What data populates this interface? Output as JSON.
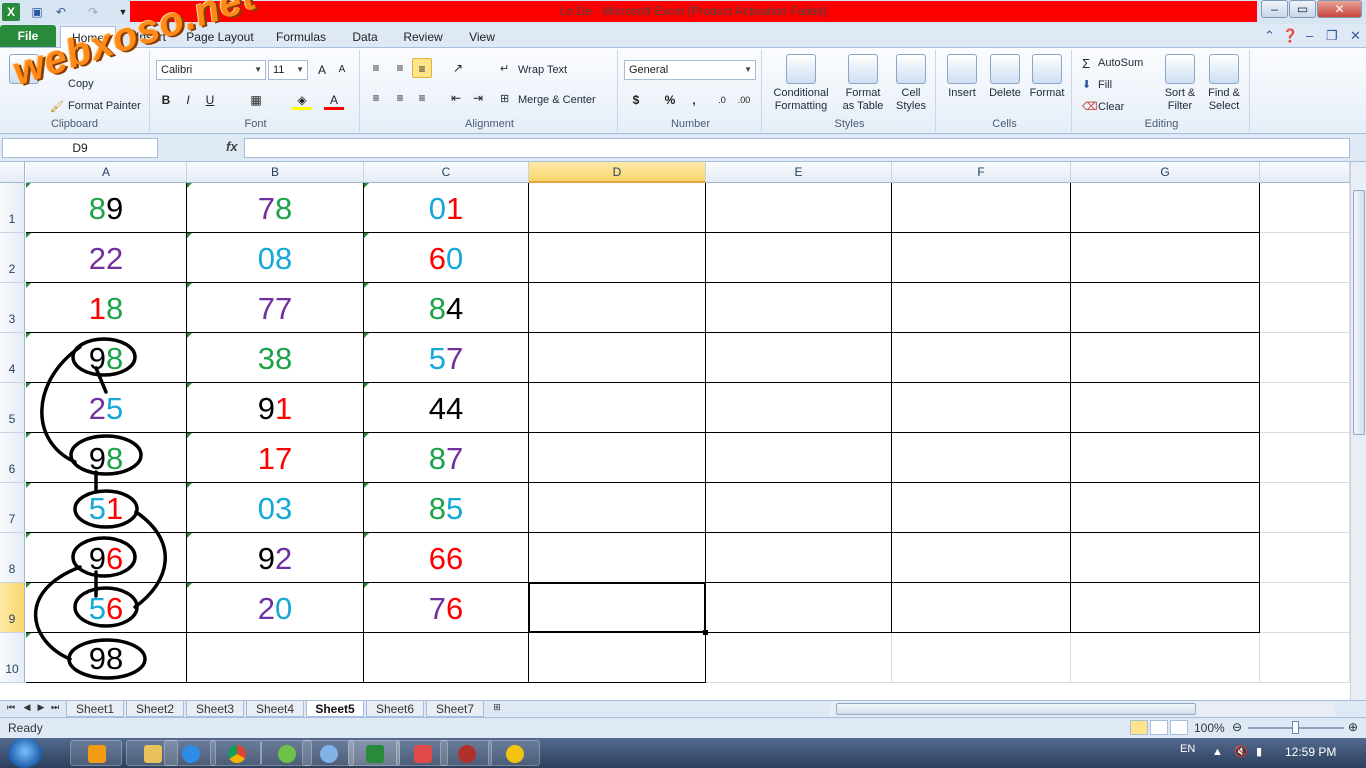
{
  "window": {
    "title": "Lo De  -  Microsoft Excel (Product Activation Failed)",
    "minimize": "‒",
    "restore": "▭",
    "close": "✕"
  },
  "watermark": "webxoso.net",
  "tabs": {
    "file": "File",
    "home": "Home",
    "insert": "Insert",
    "page_layout": "Page Layout",
    "formulas": "Formulas",
    "data": "Data",
    "review": "Review",
    "view": "View"
  },
  "ribbon": {
    "clipboard": {
      "label": "Clipboard",
      "copy": "Copy",
      "format_painter": "Format Painter"
    },
    "font": {
      "label": "Font",
      "name": "Calibri",
      "size": "11",
      "bold": "B",
      "italic": "I",
      "underline": "U"
    },
    "alignment": {
      "label": "Alignment",
      "wrap_text": "Wrap Text",
      "merge_center": "Merge & Center"
    },
    "number": {
      "label": "Number",
      "format": "General",
      "currency": "$",
      "percent": "%",
      "comma": ","
    },
    "styles": {
      "label": "Styles",
      "conditional": "Conditional",
      "formatting": "Formatting",
      "format": "Format",
      "as_table": "as Table",
      "cell": "Cell",
      "cell_styles": "Styles"
    },
    "cells": {
      "label": "Cells",
      "insert": "Insert",
      "delete": "Delete",
      "format": "Format"
    },
    "editing": {
      "label": "Editing",
      "autosum": "AutoSum",
      "fill": "Fill",
      "clear": "Clear",
      "sort": "Sort &",
      "filter": "Filter",
      "find": "Find &",
      "select": "Select"
    }
  },
  "formula_bar": {
    "name_box": "D9",
    "fx": "fx",
    "value": ""
  },
  "columns": [
    "A",
    "B",
    "C",
    "D",
    "E",
    "F",
    "G"
  ],
  "rows": [
    "1",
    "2",
    "3",
    "4",
    "5",
    "6",
    "7",
    "8",
    "9",
    "10"
  ],
  "colors": {
    "green": "#1ea34a",
    "black": "#000000",
    "purple": "#7030a0",
    "blue": "#16a8d8",
    "red": "#ff0000",
    "excel_green": "#2a8a3c",
    "title_red": "#ff0000"
  },
  "cells": {
    "A1": [
      [
        "8",
        "green"
      ],
      [
        "9",
        "black"
      ]
    ],
    "B1": [
      [
        "7",
        "purple"
      ],
      [
        "8",
        "green"
      ]
    ],
    "C1": [
      [
        "0",
        "blue"
      ],
      [
        "1",
        "red"
      ]
    ],
    "A2": [
      [
        "2",
        "purple"
      ],
      [
        "2",
        "purple"
      ]
    ],
    "B2": [
      [
        "0",
        "blue"
      ],
      [
        "8",
        "blue"
      ]
    ],
    "C2": [
      [
        "6",
        "red"
      ],
      [
        "0",
        "blue"
      ]
    ],
    "A3": [
      [
        "1",
        "red"
      ],
      [
        "8",
        "green"
      ]
    ],
    "B3": [
      [
        "7",
        "purple"
      ],
      [
        "7",
        "purple"
      ]
    ],
    "C3": [
      [
        "8",
        "green"
      ],
      [
        "4",
        "black"
      ]
    ],
    "A4": [
      [
        "9",
        "black"
      ],
      [
        "8",
        "green"
      ]
    ],
    "B4": [
      [
        "3",
        "green"
      ],
      [
        "8",
        "green"
      ]
    ],
    "C4": [
      [
        "5",
        "blue"
      ],
      [
        "7",
        "purple"
      ]
    ],
    "A5": [
      [
        "2",
        "purple"
      ],
      [
        "5",
        "blue"
      ]
    ],
    "B5": [
      [
        "9",
        "black"
      ],
      [
        "1",
        "red"
      ]
    ],
    "C5": [
      [
        "4",
        "black"
      ],
      [
        "4",
        "black"
      ]
    ],
    "A6": [
      [
        "9",
        "black"
      ],
      [
        "8",
        "green"
      ]
    ],
    "B6": [
      [
        "1",
        "red"
      ],
      [
        "7",
        "red"
      ]
    ],
    "C6": [
      [
        "8",
        "green"
      ],
      [
        "7",
        "purple"
      ]
    ],
    "A7": [
      [
        "5",
        "blue"
      ],
      [
        "1",
        "red"
      ]
    ],
    "B7": [
      [
        "0",
        "blue"
      ],
      [
        "3",
        "blue"
      ]
    ],
    "C7": [
      [
        "8",
        "green"
      ],
      [
        "5",
        "blue"
      ]
    ],
    "A8": [
      [
        "9",
        "black"
      ],
      [
        "6",
        "red"
      ]
    ],
    "B8": [
      [
        "9",
        "black"
      ],
      [
        "2",
        "purple"
      ]
    ],
    "C8": [
      [
        "6",
        "red"
      ],
      [
        "6",
        "red"
      ]
    ],
    "A9": [
      [
        "5",
        "blue"
      ],
      [
        "6",
        "red"
      ]
    ],
    "B9": [
      [
        "2",
        "purple"
      ],
      [
        "0",
        "blue"
      ]
    ],
    "C9": [
      [
        "7",
        "purple"
      ],
      [
        "6",
        "red"
      ]
    ],
    "A10": [
      [
        "9",
        "black"
      ],
      [
        "8",
        "black"
      ]
    ]
  },
  "sheets": [
    "Sheet1",
    "Sheet2",
    "Sheet3",
    "Sheet4",
    "Sheet5",
    "Sheet6",
    "Sheet7"
  ],
  "active_sheet": "Sheet5",
  "status": {
    "text": "Ready",
    "zoom": "100%"
  },
  "taskbar": {
    "lang": "EN",
    "time": "12:59 PM"
  }
}
